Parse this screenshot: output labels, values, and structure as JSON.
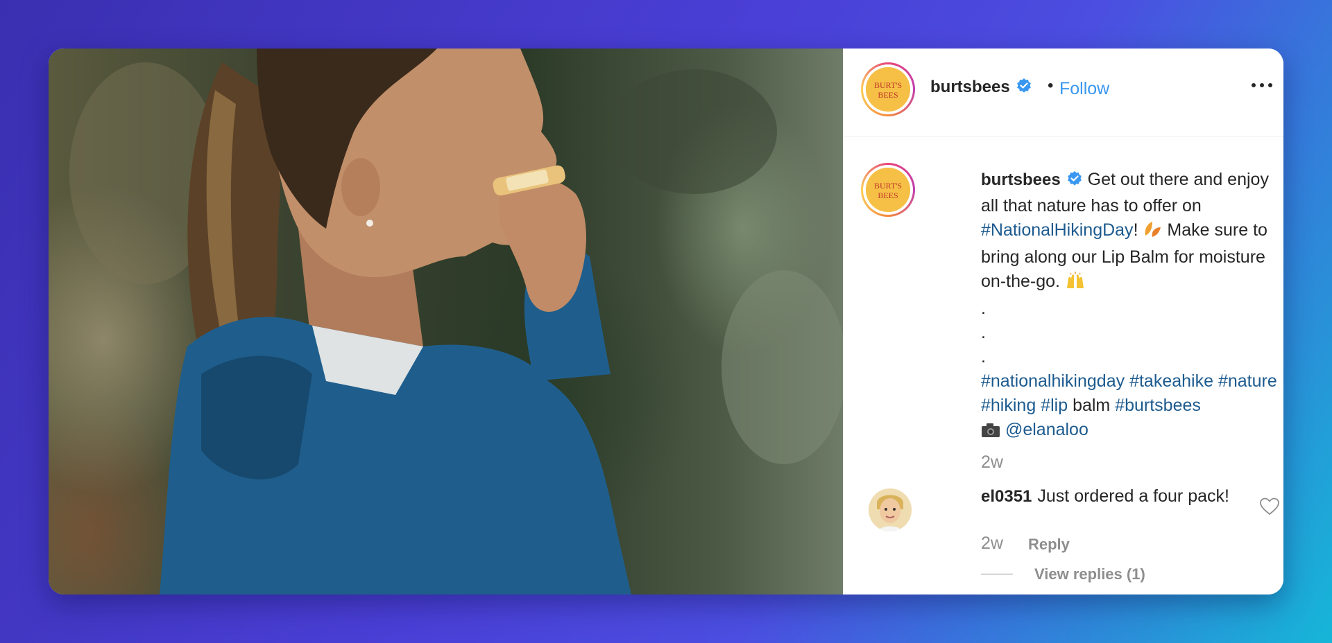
{
  "post": {
    "photo_alt": "Woman in blue rain jacket applying lip balm outdoors",
    "header": {
      "username": "burtsbees",
      "separator": "•",
      "follow_label": "Follow",
      "more_icon": "more-horizontal-icon",
      "avatar_text": "BURT'S BEES"
    },
    "caption": {
      "username": "burtsbees",
      "text_1": "Get out there and enjoy all that nature has to offer on",
      "hashtag_main": "#NationalHikingDay",
      "exclaim": "!",
      "text_2": "Make sure to bring along our Lip Balm for moisture on-the-go.",
      "dots": [
        ".",
        ".",
        "."
      ],
      "tags": [
        "#nationalhikingday",
        "#takeahike",
        "#nature",
        "#hiking",
        "#lip"
      ],
      "plain_word": "balm",
      "tag_last": "#burtsbees",
      "credit": "@elanaloo",
      "time": "2w"
    },
    "comment": {
      "username": "el0351",
      "text": "Just ordered a four pack!",
      "time": "2w",
      "reply_label": "Reply",
      "view_replies_label": "View replies (1)"
    }
  },
  "colors": {
    "link_blue": "#3897f0",
    "hashtag": "#1d5b8f",
    "muted": "#8e8e8e",
    "verified": "#3897f0"
  }
}
